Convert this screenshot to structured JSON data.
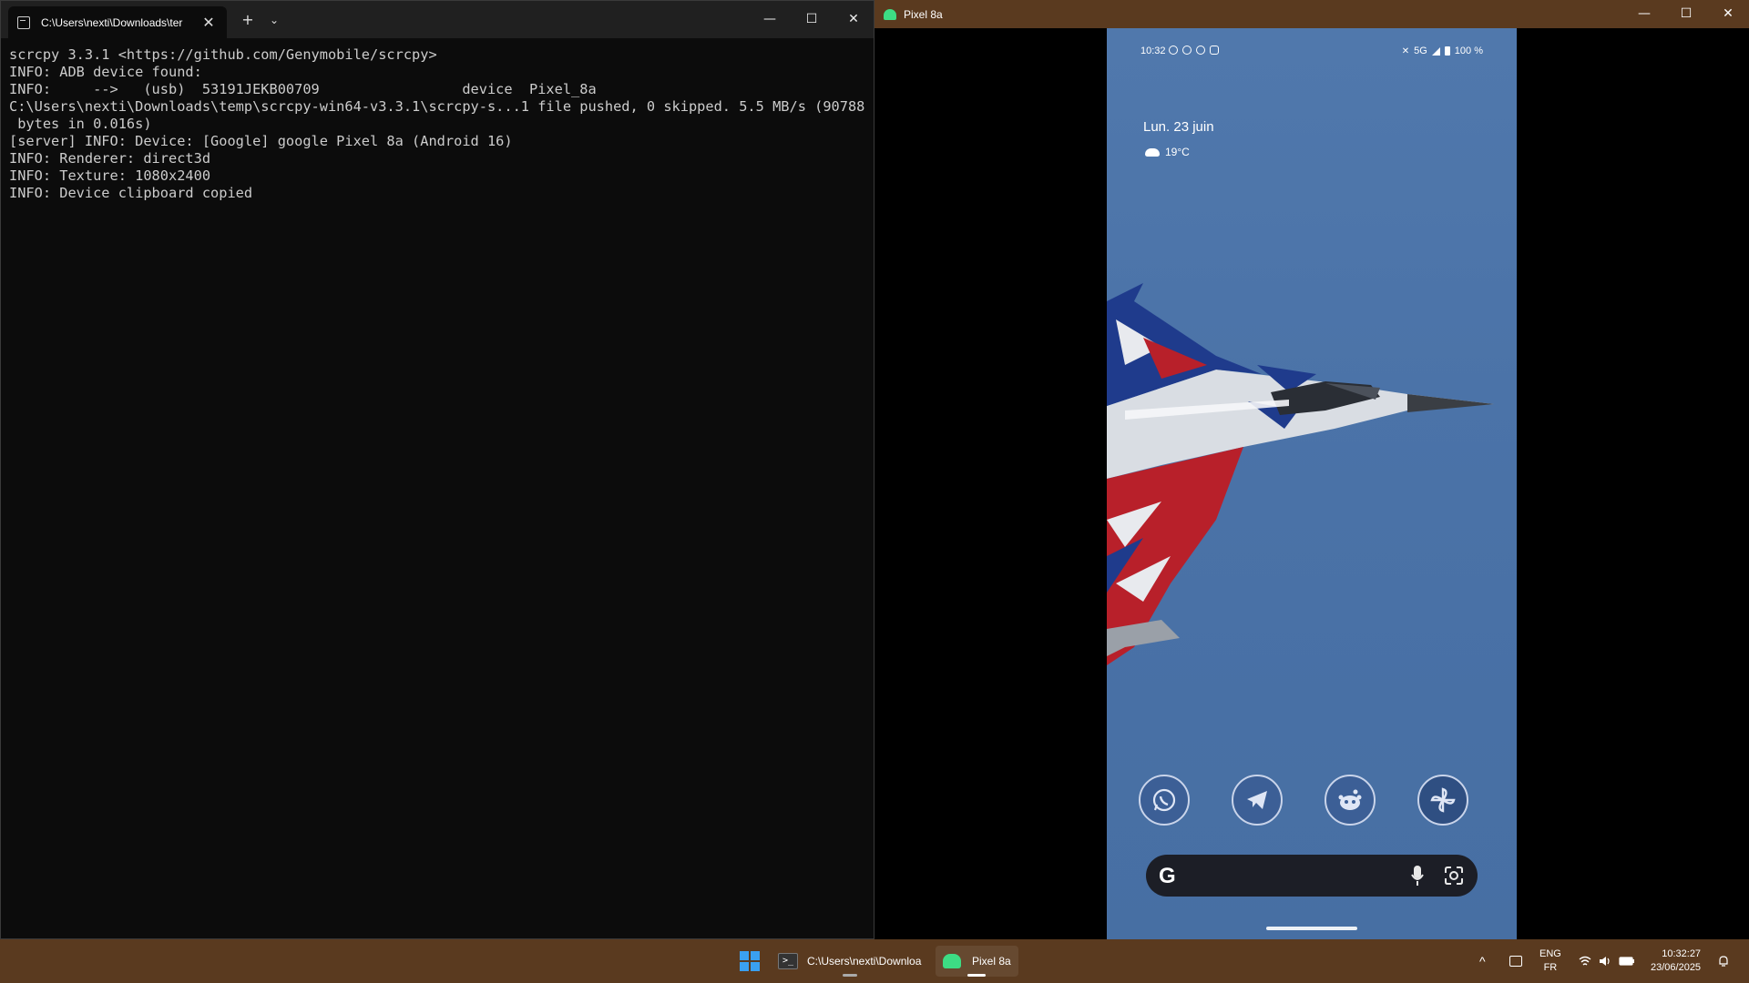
{
  "terminal": {
    "tab_title": "C:\\Users\\nexti\\Downloads\\ter",
    "tab_close": "✕",
    "new_tab": "+",
    "tab_dropdown": "⌄",
    "minimize": "—",
    "maximize": "☐",
    "close": "✕",
    "lines": [
      "scrcpy 3.3.1 <https://github.com/Genymobile/scrcpy>",
      "INFO: ADB device found:",
      "INFO:     -->   (usb)  53191JEKB00709                 device  Pixel_8a",
      "C:\\Users\\nexti\\Downloads\\temp\\scrcpy-win64-v3.3.1\\scrcpy-s...1 file pushed, 0 skipped. 5.5 MB/s (90788",
      " bytes in 0.016s)",
      "[server] INFO: Device: [Google] google Pixel 8a (Android 16)",
      "INFO: Renderer: direct3d",
      "INFO: Texture: 1080x2400",
      "INFO: Device clipboard copied"
    ]
  },
  "scrcpy": {
    "title": "Pixel 8a",
    "minimize": "—",
    "maximize": "☐",
    "close": "✕",
    "phone": {
      "status_time": "10:32",
      "status_network": "5G",
      "status_battery": "100 %",
      "date": "Lun. 23 juin",
      "weather_temp": "19°C",
      "dock_apps": [
        "whatsapp-icon",
        "telegram-icon",
        "reddit-icon",
        "pinwheel-icon"
      ],
      "search_logo": "G"
    }
  },
  "taskbar": {
    "items": [
      {
        "label": "C:\\Users\\nexti\\Downloa",
        "icon": "terminal-icon"
      },
      {
        "label": "Pixel 8a",
        "icon": "scrcpy-icon"
      }
    ],
    "tray": {
      "chevron": "^",
      "lang_top": "ENG",
      "lang_bottom": "FR",
      "time": "10:32:27",
      "date": "23/06/2025"
    }
  },
  "colors": {
    "terminal_bg": "#0c0c0c",
    "terminal_text": "#cccccc",
    "taskbar_bg": "#5a3a1f",
    "phone_sky": "#4a70a6"
  }
}
